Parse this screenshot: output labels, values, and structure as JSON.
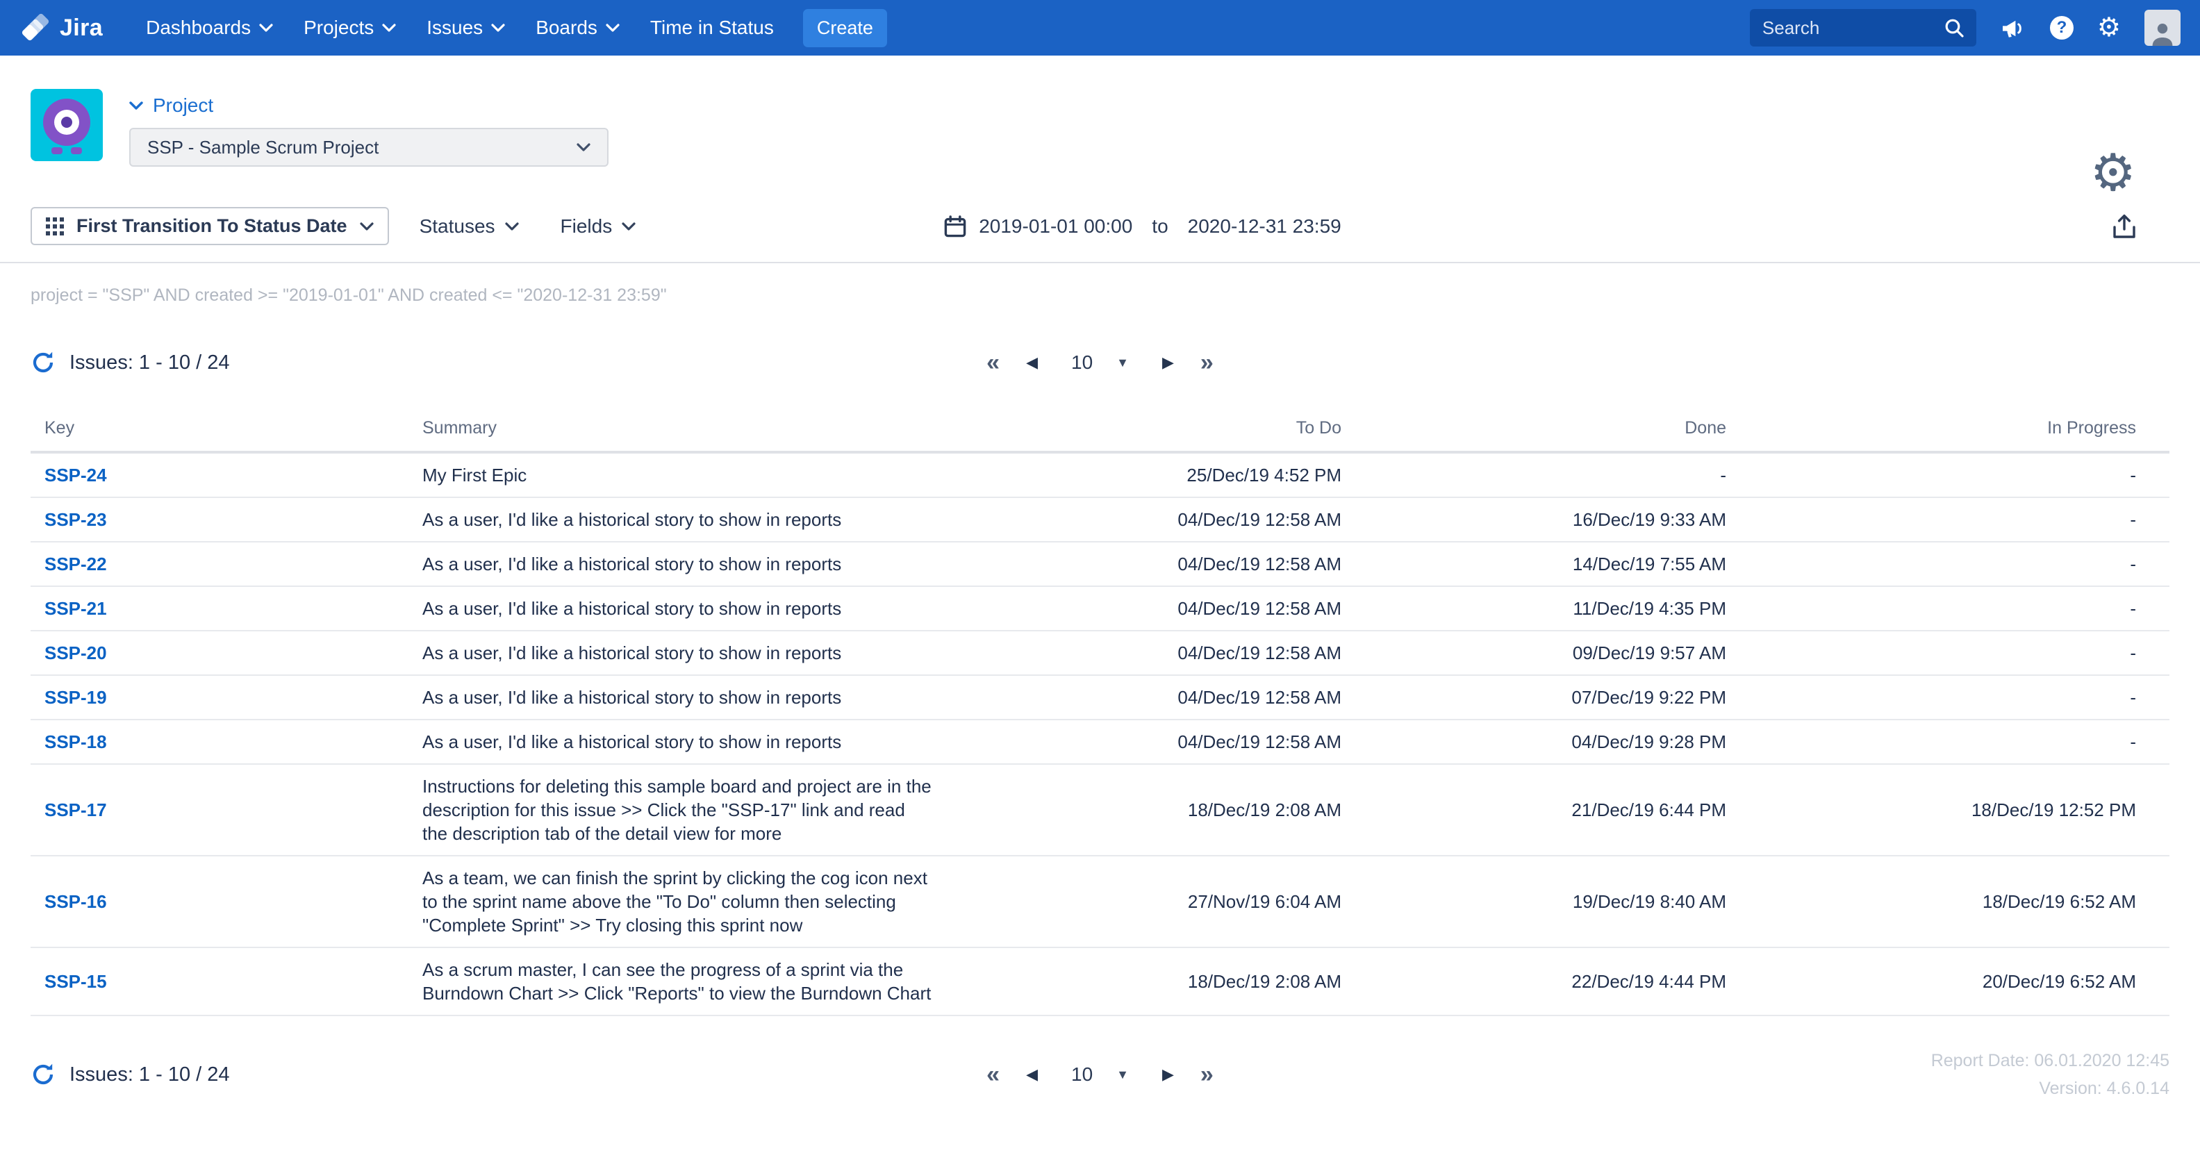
{
  "colors": {
    "navbar_blue": "#1b62c4",
    "create_blue": "#2f80e0",
    "link_blue": "#0b62c4",
    "avatar_teal": "#00c3e0",
    "avatar_purple": "#8252c7"
  },
  "navbar": {
    "brand": "Jira",
    "items": [
      {
        "label": "Dashboards"
      },
      {
        "label": "Projects"
      },
      {
        "label": "Issues"
      },
      {
        "label": "Boards"
      },
      {
        "label": "Time in Status"
      }
    ],
    "create_label": "Create",
    "search": {
      "placeholder": "Search"
    }
  },
  "header": {
    "project_label": "Project",
    "project_select_value": "SSP - Sample Scrum Project"
  },
  "toolbar": {
    "report_type_label": "First Transition To Status Date",
    "statuses_label": "Statuses",
    "fields_label": "Fields",
    "date_from": "2019-01-01 00:00",
    "date_separator": "to",
    "date_to": "2020-12-31 23:59"
  },
  "filter": {
    "jql": "project = \"SSP\" AND created >= \"2019-01-01\" AND created <= \"2020-12-31 23:59\""
  },
  "issues": {
    "summary_label": "Issues: 1 - 10 / 24"
  },
  "pagination": {
    "first": "«",
    "prev": "◀",
    "page_size": "10",
    "caret": "▼",
    "next": "▶",
    "last": "»"
  },
  "table": {
    "columns": [
      "Key",
      "Summary",
      "To Do",
      "Done",
      "In Progress"
    ],
    "rows": [
      {
        "key": "SSP-24",
        "summary": "My First Epic",
        "todo": "25/Dec/19 4:52 PM",
        "done": "-",
        "inprogress": "-"
      },
      {
        "key": "SSP-23",
        "summary": "As a user, I'd like a historical story to show in reports",
        "todo": "04/Dec/19 12:58 AM",
        "done": "16/Dec/19 9:33 AM",
        "inprogress": "-"
      },
      {
        "key": "SSP-22",
        "summary": "As a user, I'd like a historical story to show in reports",
        "todo": "04/Dec/19 12:58 AM",
        "done": "14/Dec/19 7:55 AM",
        "inprogress": "-"
      },
      {
        "key": "SSP-21",
        "summary": "As a user, I'd like a historical story to show in reports",
        "todo": "04/Dec/19 12:58 AM",
        "done": "11/Dec/19 4:35 PM",
        "inprogress": "-"
      },
      {
        "key": "SSP-20",
        "summary": "As a user, I'd like a historical story to show in reports",
        "todo": "04/Dec/19 12:58 AM",
        "done": "09/Dec/19 9:57 AM",
        "inprogress": "-"
      },
      {
        "key": "SSP-19",
        "summary": "As a user, I'd like a historical story to show in reports",
        "todo": "04/Dec/19 12:58 AM",
        "done": "07/Dec/19 9:22 PM",
        "inprogress": "-"
      },
      {
        "key": "SSP-18",
        "summary": "As a user, I'd like a historical story to show in reports",
        "todo": "04/Dec/19 12:58 AM",
        "done": "04/Dec/19 9:28 PM",
        "inprogress": "-"
      },
      {
        "key": "SSP-17",
        "summary": "Instructions for deleting this sample board and project are in the description for this issue >> Click the \"SSP-17\" link and read the description tab of the detail view for more",
        "todo": "18/Dec/19 2:08 AM",
        "done": "21/Dec/19 6:44 PM",
        "inprogress": "18/Dec/19 12:52 PM"
      },
      {
        "key": "SSP-16",
        "summary": "As a team, we can finish the sprint by clicking the cog icon next to the sprint name above the \"To Do\" column then selecting \"Complete Sprint\" >> Try closing this sprint now",
        "todo": "27/Nov/19 6:04 AM",
        "done": "19/Dec/19 8:40 AM",
        "inprogress": "18/Dec/19 6:52 AM"
      },
      {
        "key": "SSP-15",
        "summary": "As a scrum master, I can see the progress of a sprint via the Burndown Chart >> Click \"Reports\" to view the Burndown Chart",
        "todo": "18/Dec/19 2:08 AM",
        "done": "22/Dec/19 4:44 PM",
        "inprogress": "20/Dec/19 6:52 AM"
      }
    ]
  },
  "footer": {
    "report_date": "Report Date: 06.01.2020 12:45",
    "version": "Version: 4.6.0.14"
  }
}
